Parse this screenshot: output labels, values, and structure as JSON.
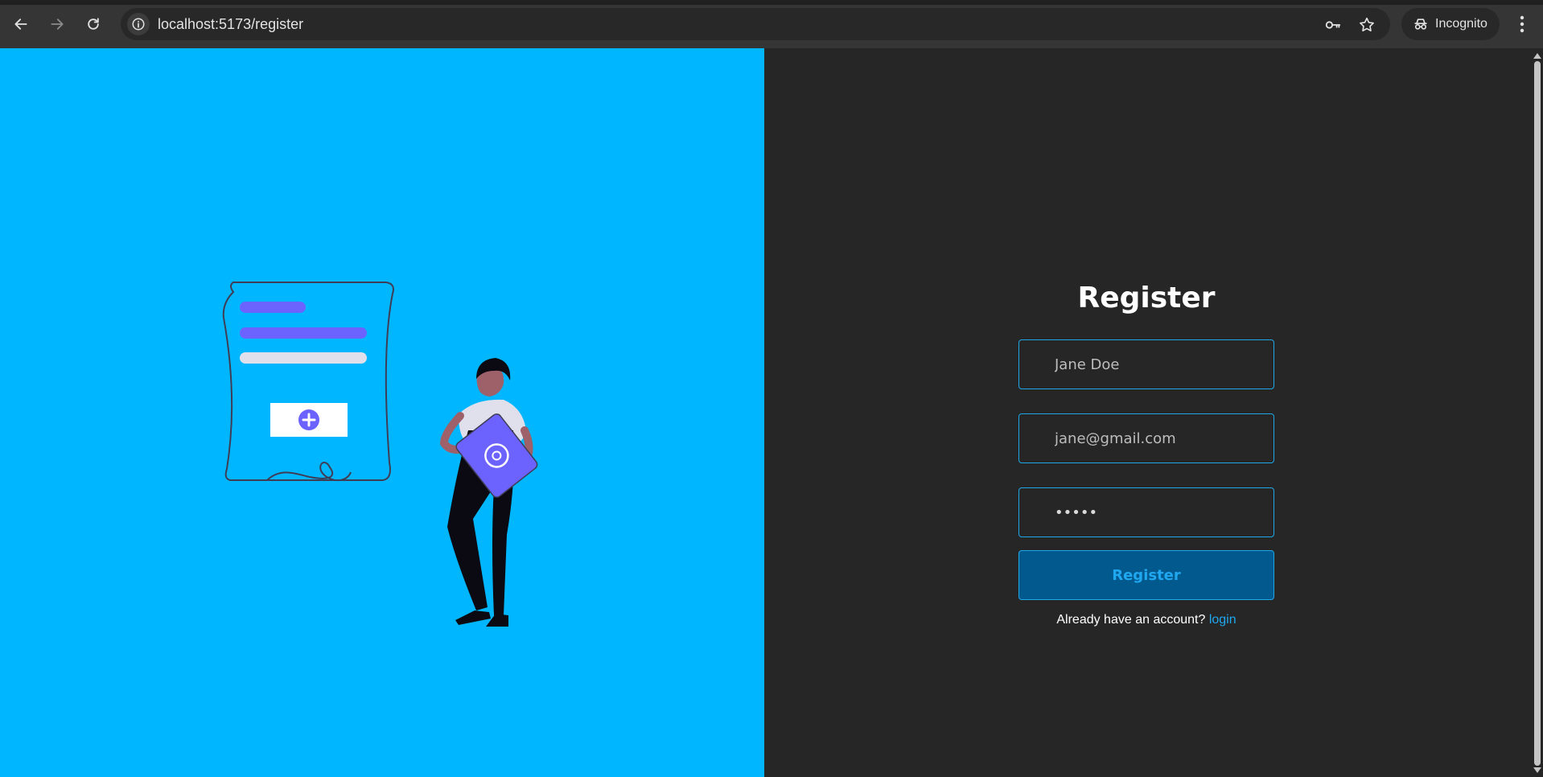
{
  "browser": {
    "url": "localhost:5173/register",
    "incognito_label": "Incognito",
    "icons": {
      "back": "arrow-left-icon",
      "forward": "arrow-right-icon",
      "reload": "reload-icon",
      "site_info": "info-icon",
      "password": "key-icon",
      "bookmark": "star-icon",
      "incognito": "incognito-icon",
      "menu": "kebab-menu-icon"
    }
  },
  "illustration": {
    "description_icon": "registration-form-illustration",
    "colors": {
      "background": "#00b7ff",
      "accent": "#6c63ff"
    }
  },
  "form": {
    "title": "Register",
    "name_placeholder": "Jane Doe",
    "email_placeholder": "jane@gmail.com",
    "password_value": "•••••",
    "submit_label": "Register",
    "footer_text": "Already have an account? ",
    "login_link": "login"
  },
  "colors": {
    "panel_dark": "#262626",
    "border_accent": "#1fa8e8",
    "button_bg": "#02598e",
    "link": "#1fa8f0"
  }
}
